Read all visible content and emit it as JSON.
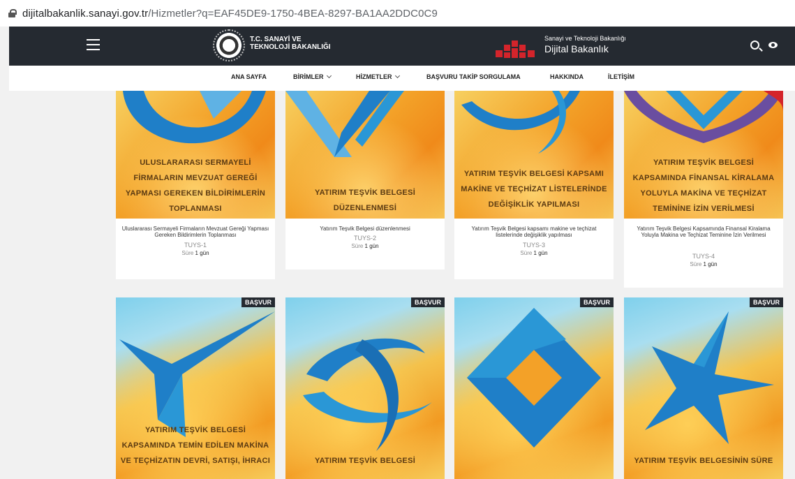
{
  "address_bar": {
    "domain": "dijitalbakanlik.sanayi.gov.tr",
    "path": "/Hizmetler?q=EAF45DE9-1750-4BEA-8297-BA1AA2DDC0C9"
  },
  "header": {
    "brand_left_line1": "T.C. SANAYİ VE",
    "brand_left_line2": "TEKNOLOJİ BAKANLIĞI",
    "brand_right_line1": "Sanayi ve Teknoloji Bakanlığı",
    "brand_right_line2": "Dijital Bakanlık",
    "icons": [
      "menu-icon",
      "search-icon",
      "eye-icon"
    ]
  },
  "nav": {
    "items": [
      {
        "label": "ANA SAYFA"
      },
      {
        "label": "BİRİMLER"
      },
      {
        "label": "HİZMETLER"
      },
      {
        "label": "BAŞVURU TAKİP SORGULAMA"
      },
      {
        "label": "HAKKINDA"
      },
      {
        "label": "İLETİŞİM"
      }
    ]
  },
  "cards_row1": [
    {
      "art_title": [
        "ULUSLARARASI SERMAYELİ",
        "FİRMALARIN MEVZUAT GEREĞİ",
        "YAPMASI GEREKEN BİLDİRİMLERİN",
        "TOPLANMASI"
      ],
      "desc": "Uluslararası Sermayeli Firmaların Mevzuat Gereği Yapması Gereken Bildirimlerin Toplanması",
      "code": "TUYS-1",
      "duration_label": "Süre",
      "duration_value": "1 gün"
    },
    {
      "art_title": [
        "YATIRIM TEŞVİK BELGESİ",
        "DÜZENLENMESİ"
      ],
      "desc": "Yatırım Teşvik Belgesi düzenlenmesi",
      "code": "TUYS-2",
      "duration_label": "Süre",
      "duration_value": "1 gün"
    },
    {
      "art_title": [
        "YATIRIM TEŞVİK BELGESİ KAPSAMI",
        "MAKİNE VE TEÇHİZAT LİSTELERİNDE",
        "DEĞİŞİKLİK YAPILMASI"
      ],
      "desc": "Yatırım Teşvik Belgesi kapsamı makine ve teçhizat listelerinde değişiklik yapılması",
      "code": "TUYS-3",
      "duration_label": "Süre",
      "duration_value": "1 gün"
    },
    {
      "art_title": [
        "YATIRIM TEŞVİK BELGESİ",
        "KAPSAMINDA FİNANSAL KİRALAMA",
        "YOLUYLA MAKİNA VE TEÇHİZAT",
        "TEMİNİNE İZİN VERİLMESİ"
      ],
      "desc": "Yatırım Teşvik Belgesi Kapsamında Finansal Kiralama Yoluyla Makina ve Teçhizat Teminine İzin Verilmesi",
      "code": "TUYS-4",
      "duration_label": "Süre",
      "duration_value": "1 gün"
    }
  ],
  "cards_row2": [
    {
      "badge": "BAŞVUR",
      "art_title": [
        "YATIRIM TEŞVİK BELGESİ",
        "KAPSAMINDA TEMİN EDİLEN MAKİNA",
        "VE TEÇHİZATIN DEVRİ, SATIŞI, İHRACI"
      ]
    },
    {
      "badge": "BAŞVUR",
      "art_title": [
        "YATIRIM TEŞVİK BELGESİ"
      ]
    },
    {
      "badge": "BAŞVUR",
      "art_title": []
    },
    {
      "badge": "BAŞVUR",
      "art_title": [
        "YATIRIM TEŞVİK BELGESİNİN SÜRE"
      ]
    }
  ]
}
